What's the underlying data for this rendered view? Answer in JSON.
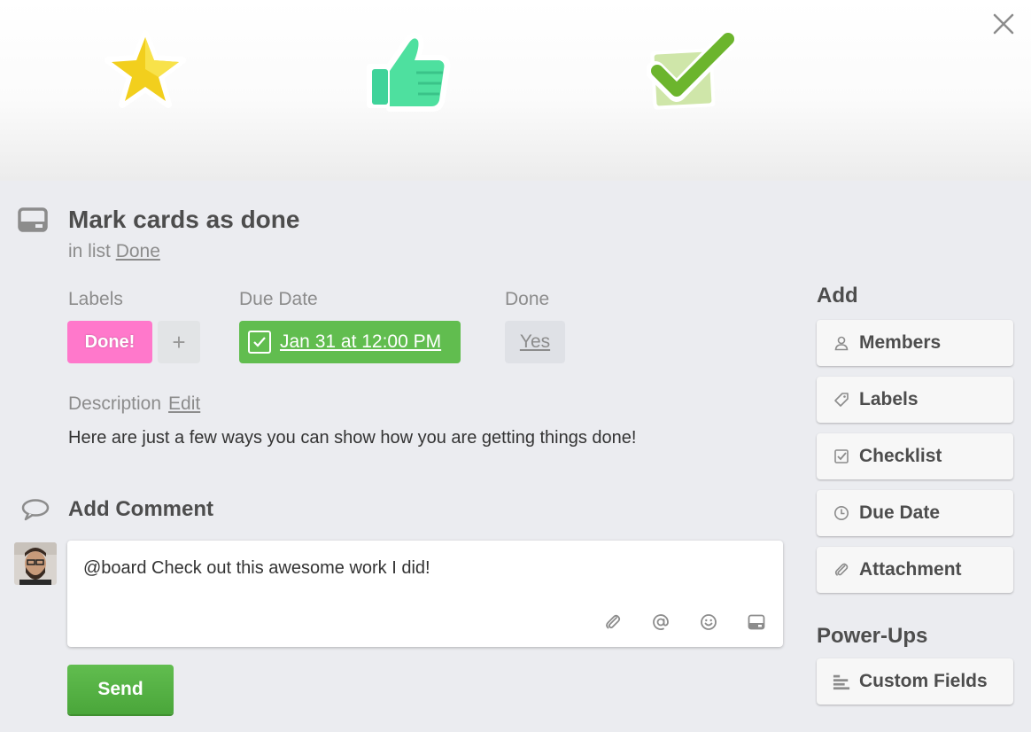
{
  "card": {
    "title": "Mark cards as done",
    "in_list_prefix": "in list",
    "list_name": "Done"
  },
  "fields": {
    "labels_heading": "Labels",
    "label_chip": "Done!",
    "label_chip_color": "#ff78cb",
    "add_label": "+",
    "due_heading": "Due Date",
    "due_value": "Jan 31 at 12:00 PM",
    "due_color": "#61bd4f",
    "done_heading": "Done",
    "done_value": "Yes"
  },
  "description": {
    "label": "Description",
    "edit": "Edit",
    "text": "Here are just a few ways you can show how you are getting things done!"
  },
  "comment": {
    "title": "Add Comment",
    "text": "@board Check out this awesome work I did!",
    "tools": [
      "paperclip-icon",
      "mention-icon",
      "emoji-icon",
      "card-icon"
    ],
    "send": "Send"
  },
  "sidebar": {
    "add_heading": "Add",
    "add_items": [
      {
        "label": "Members",
        "icon": "person-icon"
      },
      {
        "label": "Labels",
        "icon": "tag-icon"
      },
      {
        "label": "Checklist",
        "icon": "checkbox-icon"
      },
      {
        "label": "Due Date",
        "icon": "clock-icon"
      },
      {
        "label": "Attachment",
        "icon": "paperclip-icon"
      }
    ],
    "powerups_heading": "Power-Ups",
    "powerups_items": [
      {
        "label": "Custom Fields",
        "icon": "custom-fields-icon"
      }
    ]
  }
}
